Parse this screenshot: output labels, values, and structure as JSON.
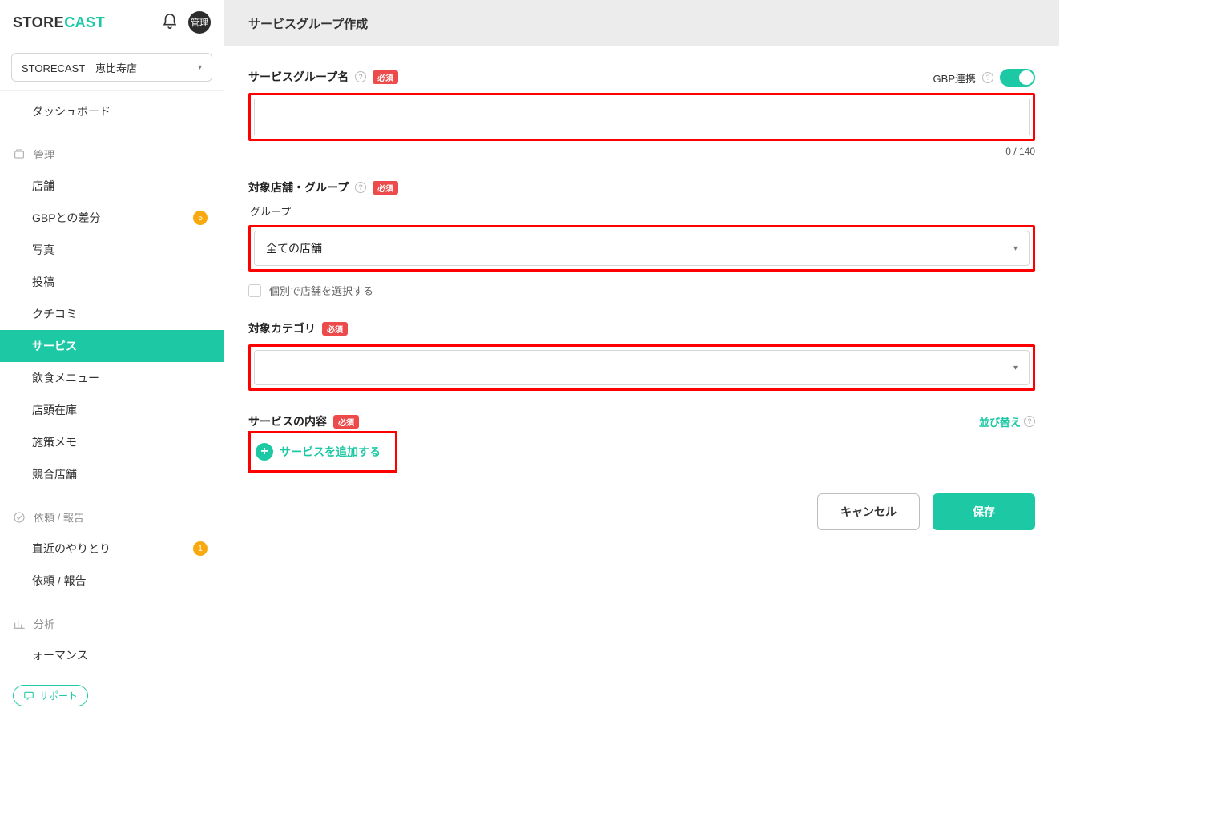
{
  "logo": {
    "part1": "STORE",
    "part2": "CAST"
  },
  "avatar_label": "管理",
  "store_selector": {
    "value": "STORECAST　恵比寿店"
  },
  "nav": {
    "dashboard": "ダッシュボード",
    "sections": [
      {
        "key": "manage",
        "title": "管理",
        "icon": "layers",
        "items": [
          {
            "key": "stores",
            "label": "店舗"
          },
          {
            "key": "gbp-diff",
            "label": "GBPとの差分",
            "badge": "5"
          },
          {
            "key": "photos",
            "label": "写真"
          },
          {
            "key": "posts",
            "label": "投稿"
          },
          {
            "key": "reviews",
            "label": "クチコミ"
          },
          {
            "key": "service",
            "label": "サービス",
            "active": true
          },
          {
            "key": "menu",
            "label": "飲食メニュー"
          },
          {
            "key": "inventory",
            "label": "店頭在庫"
          },
          {
            "key": "memo",
            "label": "施策メモ"
          },
          {
            "key": "competitors",
            "label": "競合店舗"
          }
        ]
      },
      {
        "key": "request",
        "title": "依頼 / 報告",
        "icon": "check",
        "items": [
          {
            "key": "recent",
            "label": "直近のやりとり",
            "badge": "1"
          },
          {
            "key": "reports",
            "label": "依頼 / 報告"
          }
        ]
      },
      {
        "key": "analysis",
        "title": "分析",
        "icon": "chart",
        "items": [
          {
            "key": "performance",
            "label": "ォーマンス"
          }
        ]
      }
    ]
  },
  "support_button": "サポート",
  "header": {
    "title": "サービスグループ作成"
  },
  "gbp_link": {
    "label": "GBP連携"
  },
  "labels": {
    "required": "必須",
    "service_group_name": "サービスグループ名",
    "target_store_group": "対象店舗・グループ",
    "group": "グループ",
    "group_value": "全ての店舗",
    "individual_select": "個別で店舗を選択する",
    "target_category": "対象カテゴリ",
    "service_content": "サービスの内容",
    "reorder": "並び替え",
    "add_service": "サービスを追加する",
    "cancel": "キャンセル",
    "save": "保存",
    "char_count": "0 / 140",
    "help_glyph": "?"
  }
}
